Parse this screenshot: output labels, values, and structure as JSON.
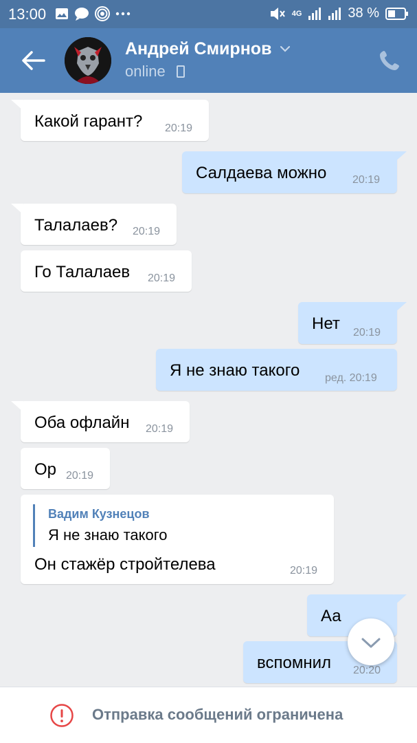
{
  "status_bar": {
    "time": "13:00",
    "network": "4G",
    "battery": "38 %",
    "icons": [
      "gallery-icon",
      "chat-icon",
      "hotspot-icon",
      "more-icon",
      "mute-icon",
      "signal-icon",
      "signal-icon",
      "battery-icon"
    ]
  },
  "header": {
    "name": "Андрей Смирнов",
    "status": "online",
    "accent_color": "#5181b8"
  },
  "messages": [
    {
      "dir": "in",
      "text": "Какой гарант?",
      "time": "20:19"
    },
    {
      "dir": "out",
      "text": "Салдаева можно",
      "time": "20:19"
    },
    {
      "dir": "in",
      "text": "Талалаев?",
      "time": "20:19"
    },
    {
      "dir": "in",
      "text": "Го Талалаев",
      "time": "20:19"
    },
    {
      "dir": "out",
      "text": "Нет",
      "time": "20:19"
    },
    {
      "dir": "out",
      "text": "Я не знаю такого",
      "time": "ред. 20:19"
    },
    {
      "dir": "in",
      "text": "Оба офлайн",
      "time": "20:19"
    },
    {
      "dir": "in",
      "text": "Ор",
      "time": "20:19"
    },
    {
      "dir": "in",
      "reply_author": "Вадим Кузнецов",
      "reply_text": "Я не знаю такого",
      "text": "Он стажёр стройтелева",
      "time": "20:19"
    },
    {
      "dir": "out",
      "text": "Аа",
      "time": ""
    },
    {
      "dir": "out",
      "text": "вспомнил",
      "time": "20:20"
    }
  ],
  "footer": {
    "notice": "Отправка сообщений ограничена"
  }
}
